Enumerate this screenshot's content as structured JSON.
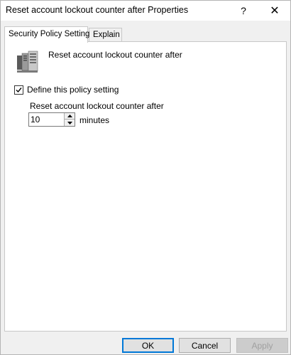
{
  "window": {
    "title": "Reset account lockout counter after Properties",
    "help_glyph": "?",
    "close_glyph": "✕"
  },
  "tabs": [
    {
      "label": "Security Policy Setting",
      "active": true
    },
    {
      "label": "Explain",
      "active": false
    }
  ],
  "policy": {
    "icon": "server-policy-icon",
    "title": "Reset account lockout counter after",
    "define_label": "Define this policy setting",
    "define_checked": true,
    "field_label": "Reset account lockout counter after",
    "value": "10",
    "unit": "minutes"
  },
  "buttons": {
    "ok": "OK",
    "cancel": "Cancel",
    "apply": "Apply"
  },
  "colors": {
    "focus_border": "#0078d7",
    "window_bg": "#f0f0f0",
    "panel_bg": "#ffffff"
  }
}
